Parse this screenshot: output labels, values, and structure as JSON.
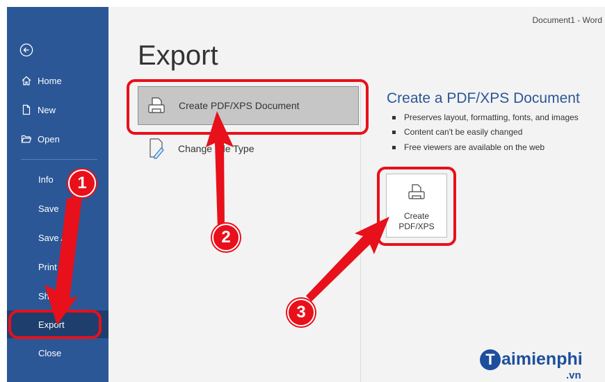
{
  "window": {
    "title": "Document1 - Word"
  },
  "sidebar": {
    "items": [
      {
        "label": "Home"
      },
      {
        "label": "New"
      },
      {
        "label": "Open"
      },
      {
        "label": "Info"
      },
      {
        "label": "Save"
      },
      {
        "label": "Save As"
      },
      {
        "label": "Print"
      },
      {
        "label": "Share"
      },
      {
        "label": "Export"
      },
      {
        "label": "Close"
      }
    ]
  },
  "main": {
    "title": "Export",
    "options": [
      {
        "label": "Create PDF/XPS Document"
      },
      {
        "label": "Change File Type"
      }
    ],
    "detail": {
      "title": "Create a PDF/XPS Document",
      "bullets": [
        "Preserves layout, formatting, fonts, and images",
        "Content can't be easily changed",
        "Free viewers are available on the web"
      ],
      "button_line1": "Create",
      "button_line2": "PDF/XPS"
    }
  },
  "annotations": {
    "badge1": "1",
    "badge2": "2",
    "badge3": "3",
    "color": "#e8101a"
  },
  "watermark": {
    "brand": "aimienphi",
    "brand_initial": "T",
    "suffix": ".vn"
  }
}
